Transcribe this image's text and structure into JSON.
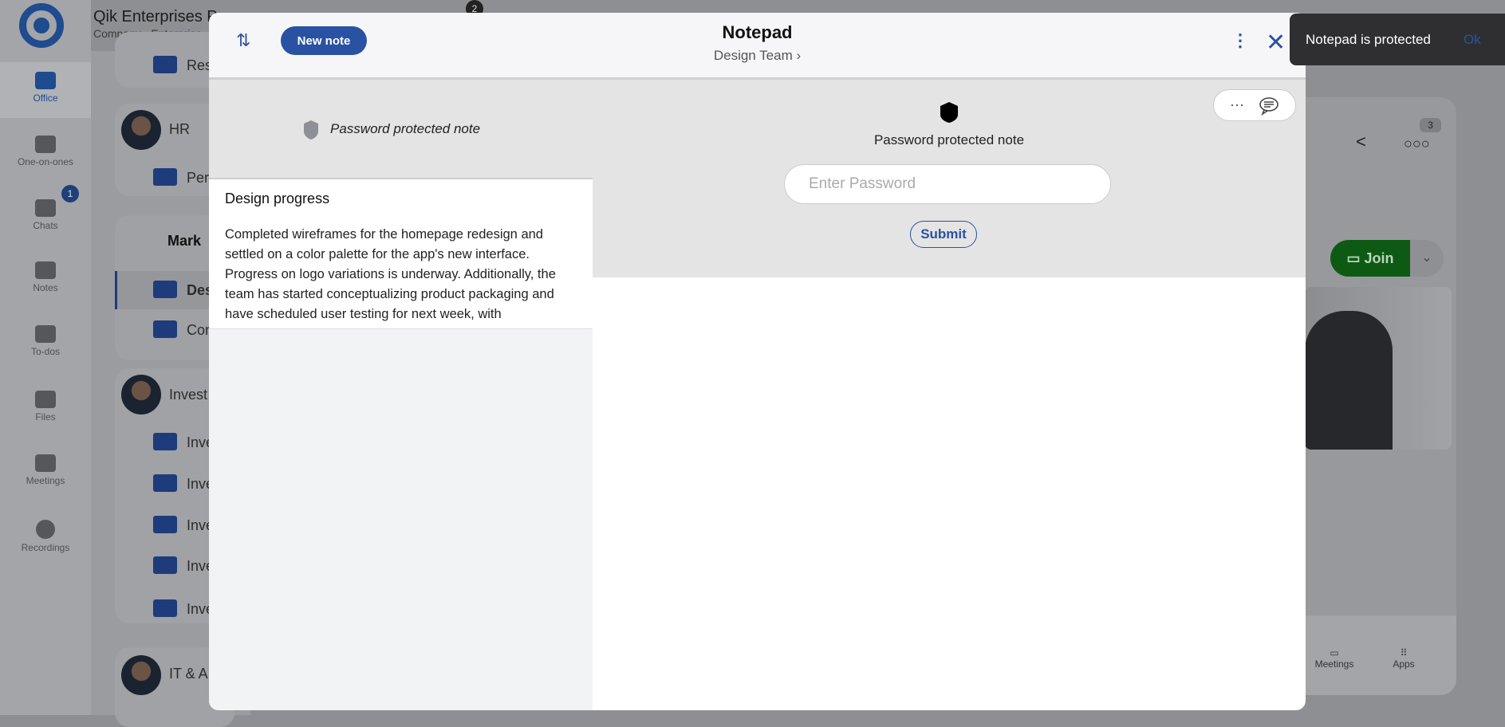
{
  "app": {
    "company": "Qik Enterprises P",
    "company_sub": "Company - Enterprise",
    "top_badge": "2"
  },
  "sidebar": {
    "items": [
      {
        "label": "Office",
        "icon": "briefcase-icon"
      },
      {
        "label": "One-on-ones",
        "icon": "people-icon"
      },
      {
        "label": "Chats",
        "icon": "chat-icon",
        "badge": "1"
      },
      {
        "label": "Notes",
        "icon": "notes-icon"
      },
      {
        "label": "To-dos",
        "icon": "todo-icon"
      },
      {
        "label": "Files",
        "icon": "files-icon"
      },
      {
        "label": "Meetings",
        "icon": "meetings-icon"
      },
      {
        "label": "Recordings",
        "icon": "recordings-icon"
      }
    ]
  },
  "channels": {
    "res": "Res",
    "hr": "HR",
    "per": "Per",
    "marketing": "Mark",
    "des": "Des",
    "con": "Con",
    "invest": "Invest",
    "inve": [
      "Inve",
      "Inve",
      "Inve",
      "Inve",
      "Inve"
    ],
    "it": "IT & A"
  },
  "right": {
    "participants_count": "3",
    "join": "Join",
    "bottom": [
      "Meetings",
      "Apps"
    ]
  },
  "modal": {
    "title": "Notepad",
    "subtitle": "Design Team",
    "new_note": "New note",
    "list_banner": "Password protected note",
    "note": {
      "title": "Design progress",
      "body": "Completed wireframes for the homepage redesign and settled on a color palette for the app's new interface. Progress on logo variations is underway. Additionally, the team has started conceptualizing product packaging and have scheduled user testing for next week, with"
    },
    "protect": {
      "title": "Password protected note",
      "placeholder": "Enter Password",
      "submit": "Submit"
    }
  },
  "toast": {
    "message": "Notepad is protected",
    "action": "Ok"
  },
  "colors": {
    "accent": "#2a52a2",
    "join": "#0e5a15",
    "toast": "#2f2f31"
  }
}
